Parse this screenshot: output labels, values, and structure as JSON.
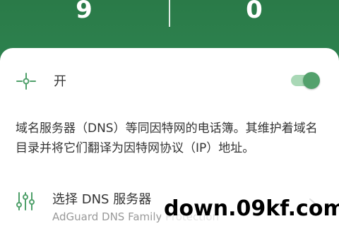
{
  "stats": {
    "left_value": "9",
    "right_value": "0"
  },
  "protection": {
    "icon": "hub-icon",
    "label": "开",
    "toggle_on": true
  },
  "description": "域名服务器（DNS）等同因特网的电话簿。其维护着域名目录并将它们翻译为因特网协议（IP）地址。",
  "dns_server": {
    "icon": "sliders-icon",
    "title": "选择 DNS 服务器",
    "subtitle": "AdGuard DNS Family Protection"
  },
  "watermark": "down.09kf.com",
  "colors": {
    "header_green": "#2e8450",
    "accent_green": "#53a16c",
    "toggle_track": "#a9d8b6",
    "text_primary": "#333333",
    "text_secondary": "#999999"
  }
}
